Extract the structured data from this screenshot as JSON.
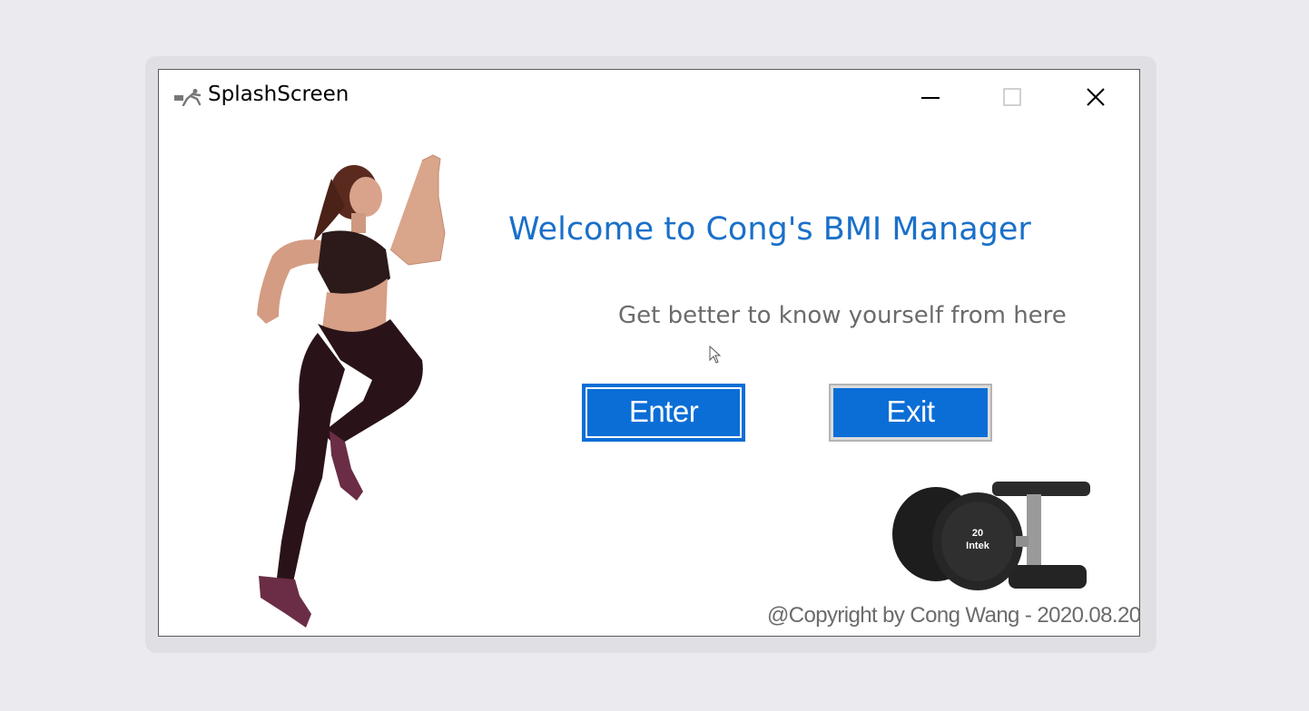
{
  "window": {
    "title": "SplashScreen",
    "icon": "running-person-icon",
    "controls": [
      "minimize-icon",
      "maximize-icon",
      "close-icon"
    ]
  },
  "splash": {
    "welcome": "Welcome to Cong's BMI Manager",
    "subtitle": "Get better to know yourself from here",
    "enter_label": "Enter",
    "exit_label": "Exit",
    "copyright": "@Copyright by Cong Wang - 2020.08.20",
    "dumbbell_weight_label": "20",
    "dumbbell_brand_label": "Intek"
  },
  "colors": {
    "accent": "#0b6ed6",
    "title_blue": "#1a70c9",
    "muted_text": "#6b6b6b",
    "window_bg": "#ffffff",
    "desktop_bg": "#ebebef"
  }
}
